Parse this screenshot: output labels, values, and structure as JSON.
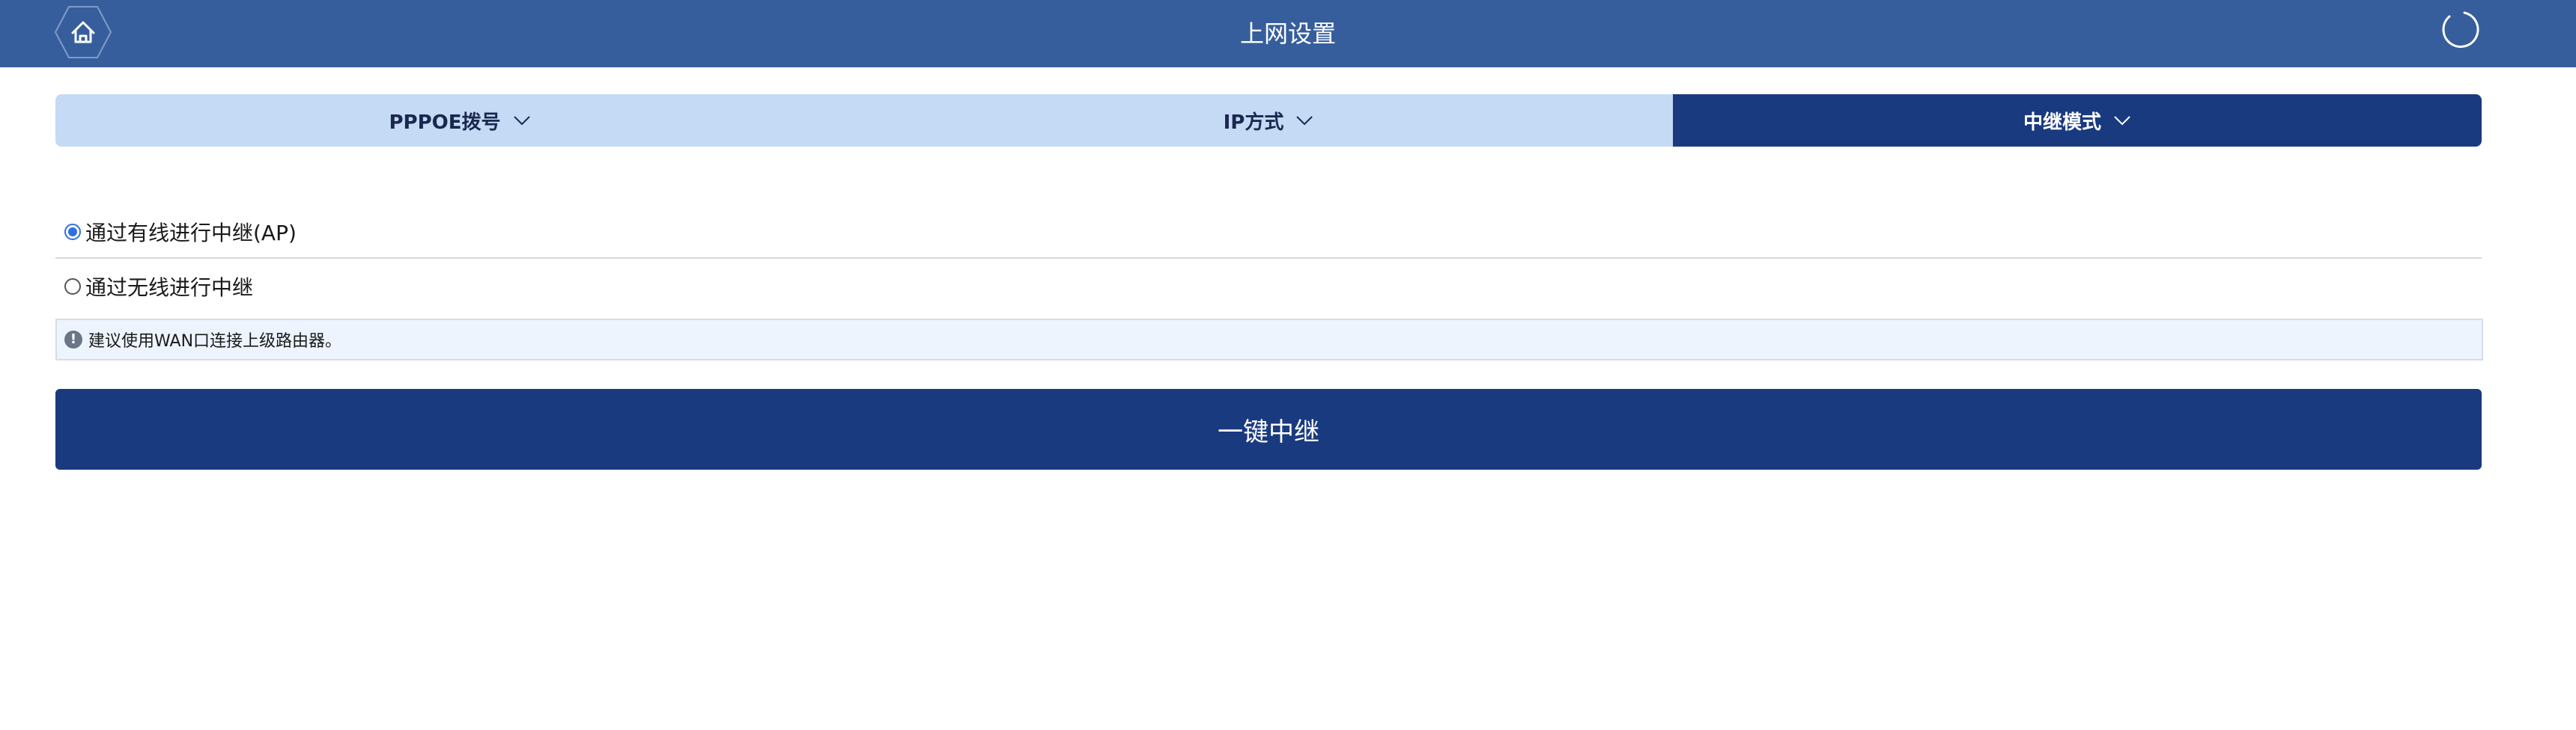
{
  "header": {
    "title": "上网设置",
    "home_icon": "home-icon",
    "refresh_icon": "refresh-icon"
  },
  "tabs": [
    {
      "label": "PPPOE拨号",
      "active": false
    },
    {
      "label": "IP方式",
      "active": false
    },
    {
      "label": "中继模式",
      "active": true
    }
  ],
  "options": [
    {
      "label": "通过有线进行中继(AP)",
      "checked": true
    },
    {
      "label": "通过无线进行中继",
      "checked": false
    }
  ],
  "notice": {
    "text": "建议使用WAN口连接上级路由器。",
    "icon": "alert-icon"
  },
  "primary_button": {
    "label": "一键中继"
  },
  "colors": {
    "header_bg": "#375e9c",
    "tab_bg": "#c5daf4",
    "tab_active_bg": "#1a3a80",
    "button_bg": "#1a3a80",
    "notice_bg": "#edf4fd"
  }
}
